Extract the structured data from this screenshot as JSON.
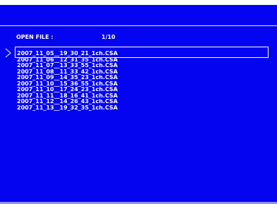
{
  "dialog": {
    "title_label": "OPEN FILE :",
    "page_counter": "1/10"
  },
  "files": [
    "2007_11_05__19_30_21_1ch.CSA",
    "2007_11_06__12_31_35_1ch.CSA",
    "2007_11_07__13_33_55_1ch.CSA",
    "2007_11_08__11_33_42_1ch.CSA",
    "2007_11_09__14_35_23_1ch.CSA",
    "2007_11_10__15_36_55_1ch.CSA",
    "2007_11_10__17_24_23_1ch.CSA",
    "2007_11_11__18_16_41_1ch.CSA",
    "2007_11_12__14_26_43_1ch.CSA",
    "2007_11_13__19_32_35_1ch.CSA"
  ],
  "selected_index": 0,
  "colors": {
    "background": "#0404F0",
    "text": "#FFFFFF"
  },
  "icons": {
    "cursor": "chevron-right-icon"
  }
}
